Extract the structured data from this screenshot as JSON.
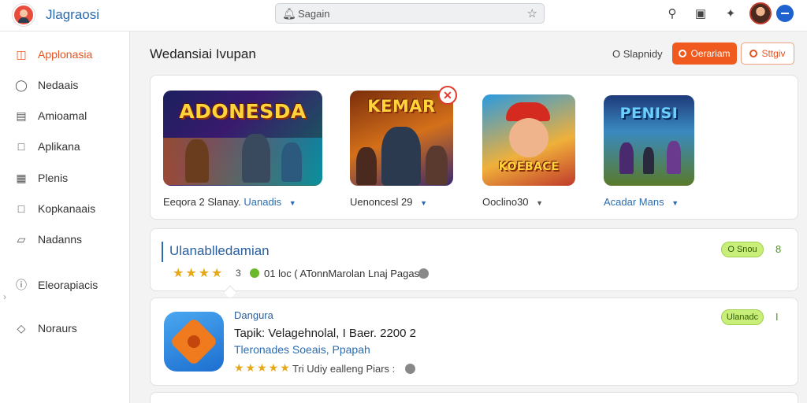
{
  "header": {
    "app_title": "Jlagraosi",
    "search_placeholder": "Sagain",
    "icons": [
      "search-icon",
      "clipboard-icon",
      "sparkle-icon"
    ]
  },
  "sidebar": {
    "items": [
      {
        "label": "Applonasia",
        "icon": "store-icon",
        "active": true
      },
      {
        "label": "Nedaais",
        "icon": "chat-icon",
        "active": false
      },
      {
        "label": "Amioamal",
        "icon": "list-icon",
        "active": false
      },
      {
        "label": "Aplikana",
        "icon": "square-icon",
        "active": false
      },
      {
        "label": "Plenis",
        "icon": "building-icon",
        "active": false
      },
      {
        "label": "Kopkanaais",
        "icon": "square-icon",
        "active": false
      },
      {
        "label": "Nadanns",
        "icon": "bookmark-icon",
        "active": false
      },
      {
        "label": "Eleorapiacis",
        "icon": "info-icon",
        "active": false
      },
      {
        "label": "Noraurs",
        "icon": "diamond-icon",
        "active": false
      }
    ]
  },
  "main": {
    "title": "Wedansiai Ivupan",
    "sort_label": "O Slapnidy",
    "primary_button": "Oerariam",
    "secondary_button": "Sttgiv"
  },
  "featured": {
    "games": [
      {
        "art_text": "ADONESDA",
        "label": "Eeqora 2 Slanay.",
        "label_link": "Uanadis"
      },
      {
        "art_text": "KEMAR",
        "label": "Uenoncesl 29",
        "label_link": ""
      },
      {
        "art_text": "KOEBACE",
        "label": "Ooclino30",
        "label_link": ""
      },
      {
        "art_text": "PENISI",
        "label": "",
        "label_link": "Acadar Mans"
      }
    ]
  },
  "list": {
    "card1": {
      "title": "Ulanablledamian",
      "stars": "★★★★",
      "count": "3",
      "meta": "01 loc ( ATonnMarolan Lnaj Pagas",
      "pill": "O Snou",
      "side_num": "8"
    },
    "card2": {
      "category": "Dangura",
      "name": "Tapik: Velagehnolal, I Baer. 2200 2",
      "tags": "Tleronades Soeais, Ppapah",
      "stars": "★★★★★",
      "rating_text": "Tri Udiy ealleng Piars :",
      "pill": "Ulanadc",
      "side_num": "I"
    }
  }
}
